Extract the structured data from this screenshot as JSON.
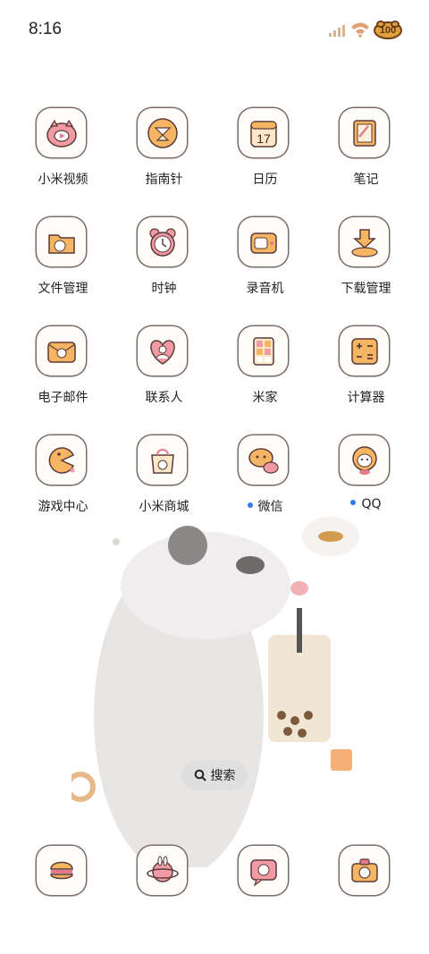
{
  "status": {
    "time": "8:16",
    "battery": "100"
  },
  "apps": [
    {
      "label": "小米视频",
      "icon": "xiaomi-video-icon"
    },
    {
      "label": "指南针",
      "icon": "compass-icon"
    },
    {
      "label": "日历",
      "icon": "calendar-icon",
      "day": "17"
    },
    {
      "label": "笔记",
      "icon": "notes-icon"
    },
    {
      "label": "文件管理",
      "icon": "folder-icon"
    },
    {
      "label": "时钟",
      "icon": "alarm-clock-icon"
    },
    {
      "label": "录音机",
      "icon": "recorder-icon"
    },
    {
      "label": "下载管理",
      "icon": "download-icon"
    },
    {
      "label": "电子邮件",
      "icon": "mail-icon"
    },
    {
      "label": "联系人",
      "icon": "contacts-icon"
    },
    {
      "label": "米家",
      "icon": "mijia-icon"
    },
    {
      "label": "计算器",
      "icon": "calculator-icon"
    },
    {
      "label": "游戏中心",
      "icon": "game-center-icon"
    },
    {
      "label": "小米商城",
      "icon": "mi-store-icon"
    },
    {
      "label": "微信",
      "icon": "wechat-icon",
      "new": true
    },
    {
      "label": "QQ",
      "icon": "qq-icon",
      "new": true
    }
  ],
  "search": {
    "label": "搜索"
  },
  "dock": [
    {
      "icon": "burger-phone-icon"
    },
    {
      "icon": "planet-bunny-icon"
    },
    {
      "icon": "cat-message-icon"
    },
    {
      "icon": "camera-icon"
    }
  ]
}
